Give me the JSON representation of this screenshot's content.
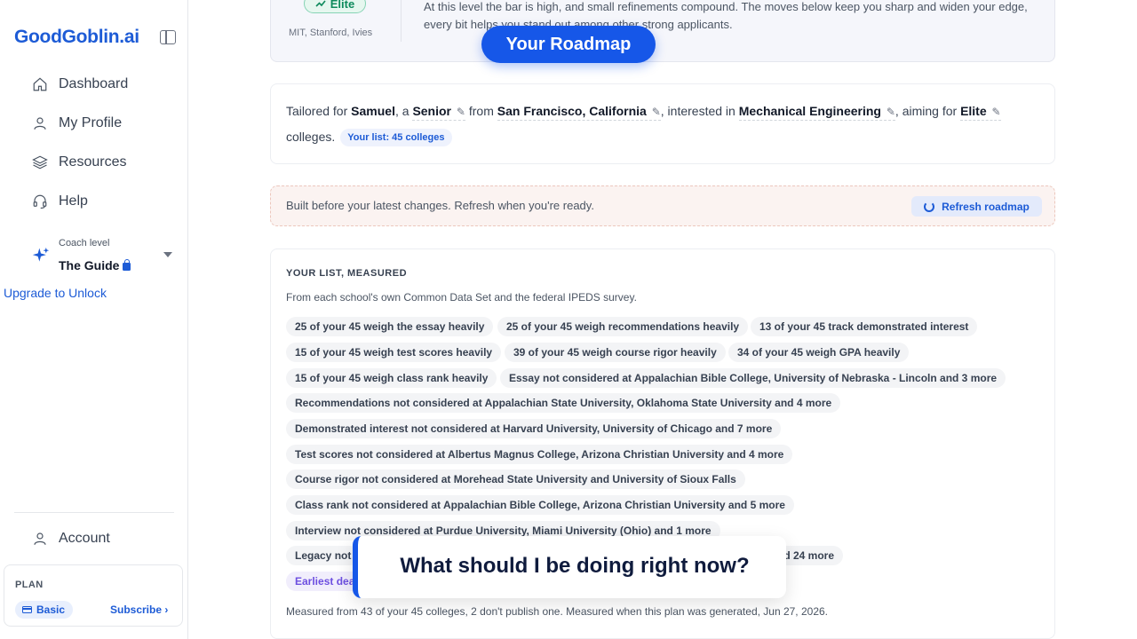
{
  "app": {
    "logo": "GoodGoblin.ai"
  },
  "sidebar": {
    "items": [
      {
        "label": "Dashboard",
        "icon": "home-icon"
      },
      {
        "label": "My Profile",
        "icon": "user-icon"
      },
      {
        "label": "Resources",
        "icon": "layers-icon"
      },
      {
        "label": "Help",
        "icon": "headset-icon"
      }
    ],
    "coach": {
      "label": "Coach level",
      "value": "The Guide"
    },
    "upgrade": "Upgrade to Unlock",
    "account": "Account",
    "plan": {
      "label": "PLAN",
      "tier": "Basic",
      "subscribe": "Subscribe ›"
    }
  },
  "top_card": {
    "badge": "Elite",
    "badge_sub": "MIT, Stanford, Ivies",
    "text": "At this level the bar is high, and small refinements compound. The moves below keep you sharp and widen your edge, every bit helps you stand out among other strong applicants."
  },
  "overlay": {
    "roadmap_title": "Your Roadmap",
    "question": "What should I be doing right now?"
  },
  "tailor": {
    "p1": "Tailored for ",
    "name": "Samuel",
    "p2": ", a ",
    "grade": "Senior",
    "p3": " from ",
    "location": "San Francisco, California",
    "p4": ", interested in ",
    "interest": "Mechanical Engineering",
    "p5": ", aiming for ",
    "aim": "Elite",
    "p6": "colleges.",
    "list_chip": "Your list: 45 colleges",
    "pencil": "✎"
  },
  "notice": {
    "text": "Built before your latest changes. Refresh when you're ready.",
    "button": "Refresh roadmap"
  },
  "measured": {
    "title": "YOUR LIST, MEASURED",
    "subtitle": "From each school's own Common Data Set and the federal IPEDS survey.",
    "chips": [
      "25 of your 45 weigh the essay heavily",
      "25 of your 45 weigh recommendations heavily",
      "13 of your 45 track demonstrated interest",
      "15 of your 45 weigh test scores heavily",
      "39 of your 45 weigh course rigor heavily",
      "34 of your 45 weigh GPA heavily",
      "15 of your 45 weigh class rank heavily",
      "Essay not considered at Appalachian Bible College, University of Nebraska - Lincoln and 3 more",
      "Recommendations not considered at Appalachian State University, Oklahoma State University and 4 more",
      "Demonstrated interest not considered at Harvard University, University of Chicago and 7 more",
      "Test scores not considered at Albertus Magnus College, Arizona Christian University and 4 more",
      "Course rigor not considered at Morehead State University and University of Sioux Falls",
      "Class rank not considered at Appalachian Bible College, Arizona Christian University and 5 more",
      "Interview not considered at Purdue University, Miami University (Ohio) and 1 more",
      "Legacy not",
      "nd 24 more",
      "Earliest dea"
    ],
    "footer": "Measured from 43 of your 45 colleges, 2 don't publish one. Measured when this plan was generated, Jun 27, 2026."
  }
}
